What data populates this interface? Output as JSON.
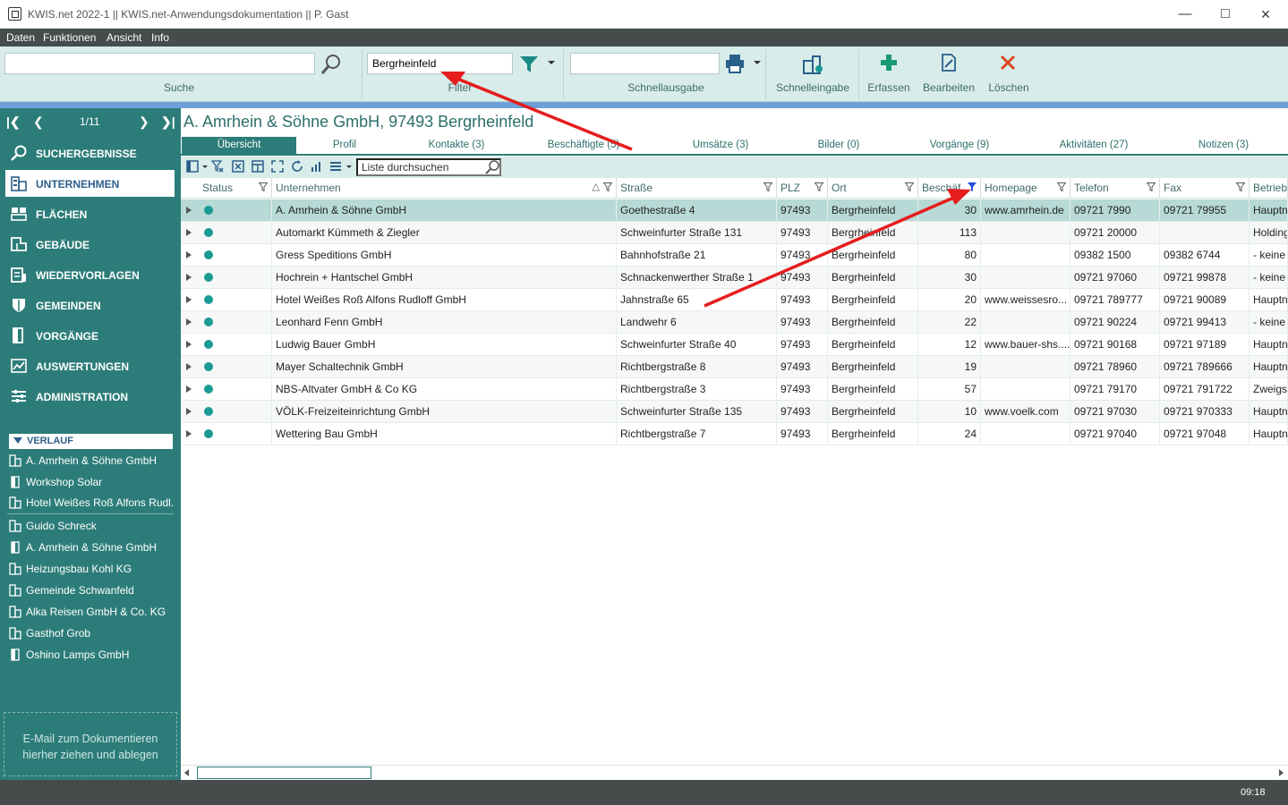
{
  "window": {
    "title": "KWIS.net 2022-1 || KWIS.net-Anwendungsdokumentation || P. Gast"
  },
  "menu": [
    "Daten",
    "Funktionen",
    "Ansicht",
    "Info"
  ],
  "ribbon": {
    "search": {
      "value": "",
      "label": "Suche"
    },
    "filter": {
      "value": "Bergrheinfeld",
      "label": "Filter"
    },
    "quickout": {
      "value": "",
      "label": "Schnellausgabe"
    },
    "quickentry": "Schnelleingabe",
    "capture": "Erfassen",
    "edit": "Bearbeiten",
    "delete": "Löschen"
  },
  "pager": {
    "text": "1/11"
  },
  "nav": [
    {
      "label": "SUCHERGEBNISSE",
      "icon": "search-icon"
    },
    {
      "label": "UNTERNEHMEN",
      "icon": "building-icon"
    },
    {
      "label": "FLÄCHEN",
      "icon": "area-icon"
    },
    {
      "label": "GEBÄUDE",
      "icon": "building-plan-icon"
    },
    {
      "label": "WIEDERVORLAGEN",
      "icon": "reminder-icon"
    },
    {
      "label": "GEMEINDEN",
      "icon": "shield-icon"
    },
    {
      "label": "VORGÄNGE",
      "icon": "process-icon"
    },
    {
      "label": "AUSWERTUNGEN",
      "icon": "chart-icon"
    },
    {
      "label": "ADMINISTRATION",
      "icon": "admin-icon"
    }
  ],
  "verlauf": {
    "title": "VERLAUF",
    "items": [
      "A. Amrhein & Söhne GmbH",
      "Workshop Solar",
      "Hotel Weißes Roß Alfons Rudl...",
      "Guido Schreck",
      "A. Amrhein & Söhne GmbH",
      "Heizungsbau Kohl KG",
      "Gemeinde Schwanfeld",
      "Alka Reisen GmbH & Co. KG",
      "Gasthof Grob",
      "Oshino Lamps GmbH"
    ]
  },
  "dropzone": {
    "line1": "E-Mail  zum Dokumentieren",
    "line2": "hierher ziehen und ablegen"
  },
  "main": {
    "title": "A. Amrhein & Söhne GmbH, 97493 Bergrheinfeld"
  },
  "tabs": [
    "Übersicht",
    "Profil",
    "Kontakte (3)",
    "Beschäftigte (5)",
    "Umsätze (3)",
    "Bilder (0)",
    "Vorgänge (9)",
    "Aktivitäten (27)",
    "Notizen (3)"
  ],
  "grid": {
    "search_placeholder": "Liste durchsuchen",
    "columns": [
      "Status",
      "Unternehmen",
      "Straße",
      "PLZ",
      "Ort",
      "Beschäf...",
      "Homepage",
      "Telefon",
      "Fax",
      "Betrieb"
    ],
    "rows": [
      [
        "A. Amrhein & Söhne GmbH",
        "Goethestraße 4",
        "97493",
        "Bergrheinfeld",
        "30",
        "www.amrhein.de",
        "09721 7990",
        "09721 79955",
        "Hauptn"
      ],
      [
        "Automarkt Kümmeth & Ziegler",
        "Schweinfurter Straße 131",
        "97493",
        "Bergrheinfeld",
        "113",
        "",
        "09721 20000",
        "",
        "Holding"
      ],
      [
        "Gress Speditions GmbH",
        "Bahnhofstraße 21",
        "97493",
        "Bergrheinfeld",
        "80",
        "",
        "09382 1500",
        "09382 6744",
        "- keine"
      ],
      [
        "Hochrein + Hantschel GmbH",
        "Schnackenwerther Straße 1",
        "97493",
        "Bergrheinfeld",
        "30",
        "",
        "09721 97060",
        "09721 99878",
        "- keine"
      ],
      [
        "Hotel Weißes Roß Alfons Rudloff GmbH",
        "Jahnstraße 65",
        "97493",
        "Bergrheinfeld",
        "20",
        "www.weissesro...",
        "09721 789777",
        "09721 90089",
        "Hauptn"
      ],
      [
        "Leonhard Fenn GmbH",
        "Landwehr 6",
        "97493",
        "Bergrheinfeld",
        "22",
        "",
        "09721 90224",
        "09721 99413",
        "- keine"
      ],
      [
        "Ludwig Bauer GmbH",
        "Schweinfurter Straße 40",
        "97493",
        "Bergrheinfeld",
        "12",
        "www.bauer-shs....",
        "09721 90168",
        "09721 97189",
        "Hauptn"
      ],
      [
        "Mayer Schaltechnik GmbH",
        "Richtbergstraße 8",
        "97493",
        "Bergrheinfeld",
        "19",
        "",
        "09721 78960",
        "09721 789666",
        "Hauptn"
      ],
      [
        "NBS-Altvater GmbH & Co KG",
        "Richtbergstraße 3",
        "97493",
        "Bergrheinfeld",
        "57",
        "",
        "09721 79170",
        "09721 791722",
        "Zweigs"
      ],
      [
        "VÖLK-Freizeiteinrichtung GmbH",
        "Schweinfurter Straße 135",
        "97493",
        "Bergrheinfeld",
        "10",
        "www.voelk.com",
        "09721 97030",
        "09721 970333",
        "Hauptn"
      ],
      [
        "Wettering Bau GmbH",
        "Richtbergstraße 7",
        "97493",
        "Bergrheinfeld",
        "24",
        "",
        "09721 97040",
        "09721 97048",
        "Hauptn"
      ]
    ]
  },
  "status": {
    "time": "09:18"
  },
  "colors": {
    "accent": "#2c7d79",
    "ribbon": "#d8ecea",
    "arrow": "#e51d1d",
    "status_dot": "#1a9a93"
  }
}
